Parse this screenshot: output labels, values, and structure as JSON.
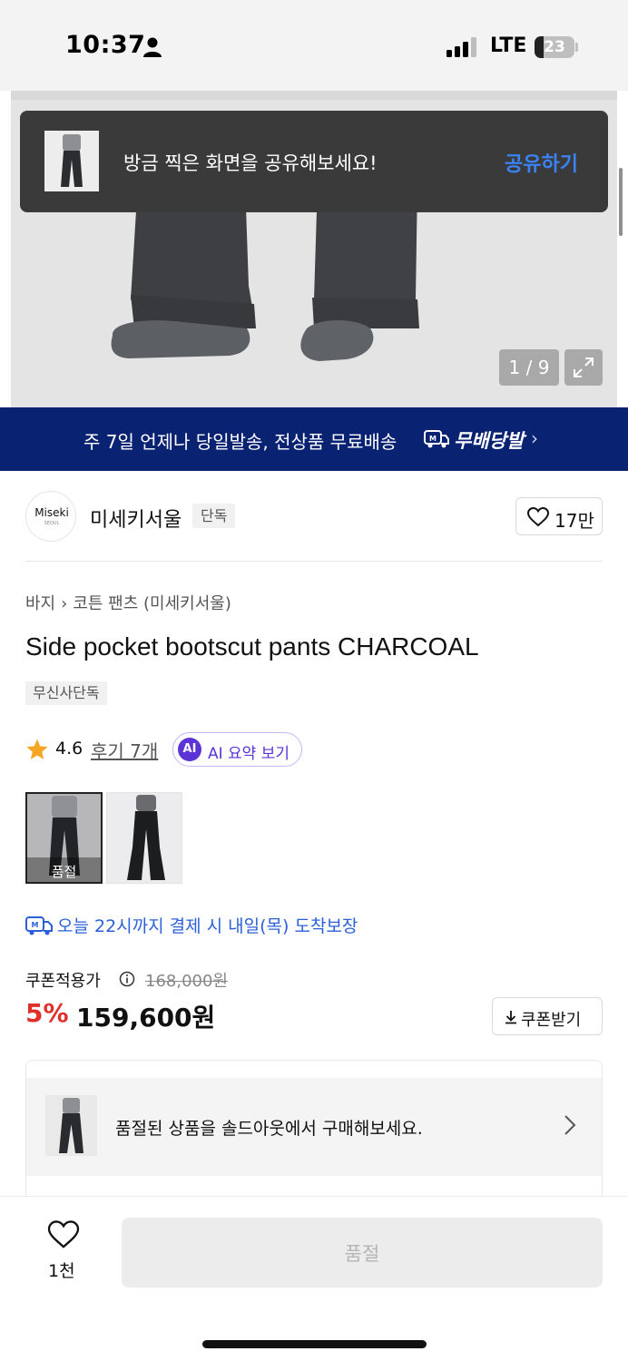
{
  "status_bar": {
    "time": "10:37",
    "network": "LTE",
    "battery": "23"
  },
  "gallery": {
    "counter": "1 / 9"
  },
  "share_toast": {
    "message": "방금 찍은 화면을 공유해보세요!",
    "action": "공유하기"
  },
  "banner": {
    "text": "주 7일 언제나 당일발송, 전상품 무료배송",
    "brand": "무배당발",
    "chevron": "›"
  },
  "brand": {
    "logo_text": "Miseki",
    "logo_sub": "SEOUL",
    "name": "미세키서울",
    "badge": "단독",
    "likes": "17만"
  },
  "breadcrumb": {
    "category": "바지",
    "separator": "›",
    "subcategory": "코튼 팬츠 (미세키서울)"
  },
  "product": {
    "title": "Side pocket bootscut pants CHARCOAL",
    "tag": "무신사단독",
    "rating": "4.6",
    "reviews": "후기 7개",
    "ai_badge": "AI",
    "ai_label": "AI 요약 보기",
    "soldout_option_label": "품절"
  },
  "delivery": {
    "text": "오늘 22시까지 결제 시 내일(목) 도착보장"
  },
  "price": {
    "coupon_label": "쿠폰적용가",
    "original": "168,000원",
    "discount": "5%",
    "final": "159,600원",
    "coupon_button": "쿠폰받기"
  },
  "soldout_card": {
    "text": "품절된 상품을 솔드아웃에서 구매해보세요."
  },
  "bottom_bar": {
    "wish_count": "1천",
    "buy_label": "품절"
  },
  "colors": {
    "banner": "#0a2272",
    "accent_blue": "#2b5fd9",
    "discount_red": "#e0302a",
    "ai_purple": "#5b33d6"
  }
}
